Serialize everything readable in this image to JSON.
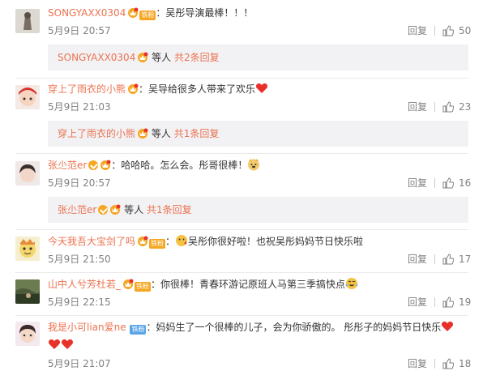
{
  "comments": [
    {
      "username": "SONGYAXX0304",
      "fan_badge": "铁粉",
      "text": "：吴彤导演最棒！！！",
      "date": "5月9日 20:57",
      "reply_label": "回复",
      "likes": "50",
      "sub": {
        "username": "SONGYAXX0304",
        "others": "等人",
        "count": "共2条回复"
      }
    },
    {
      "username": "穿上了雨衣的小熊",
      "text": "：吴导给很多人带来了欢乐",
      "date": "5月9日 21:03",
      "reply_label": "回复",
      "likes": "23",
      "sub": {
        "username": "穿上了雨衣的小熊",
        "others": "等人",
        "count": "共1条回复"
      }
    },
    {
      "username": "张尐范er",
      "text": "：哈哈哈。怎么会。彤哥很棒！",
      "date": "5月9日 20:57",
      "reply_label": "回复",
      "likes": "16",
      "sub": {
        "username": "张尐范er",
        "others": "等人",
        "count": "共1条回复"
      }
    },
    {
      "username": "今天我吾大宝剑了吗",
      "fan_badge": "铁粉",
      "text": "吴彤你很好啦！也祝吴彤妈妈节日快乐啦",
      "date": "5月9日 21:50",
      "reply_label": "回复",
      "likes": "17"
    },
    {
      "username": "山中人兮芳杜若_",
      "fan_badge": "铁粉",
      "text": "：你很棒！青春环游记原班人马第三季搞快点",
      "date": "5月9日 22:15",
      "reply_label": "回复",
      "likes": "19"
    },
    {
      "username": "我是小可lian爱ne",
      "fan_badge": "铁粉",
      "text": "：妈妈生了一个很棒的儿子，会为你骄傲的。 彤彤子的妈妈节日快乐",
      "date": "5月9日 21:07",
      "reply_label": "回复",
      "likes": "18"
    }
  ],
  "colors": {
    "username": "#eb7350",
    "meta": "#808080",
    "subbox_bg": "#f2f2f5",
    "heart": "#e8312a"
  },
  "icons": {
    "like": "thumbs-up-icon",
    "heart": "heart-emoji",
    "vip": "vip-v-icon",
    "crown": "fan-crown-icon"
  }
}
